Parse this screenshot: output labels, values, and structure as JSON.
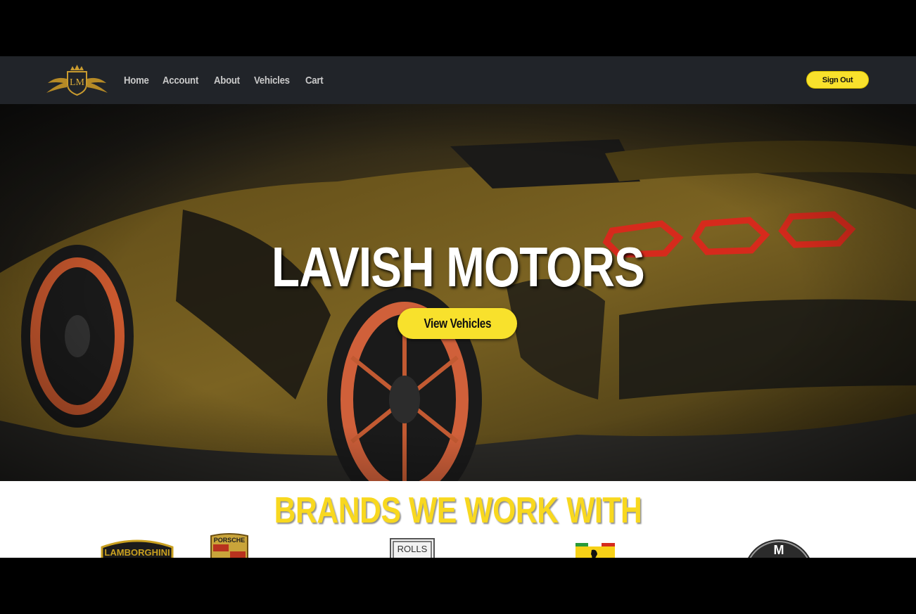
{
  "brand": {
    "logo_text": "LM"
  },
  "nav": {
    "items": [
      {
        "label": "Home"
      },
      {
        "label": "Account"
      },
      {
        "label": "About"
      },
      {
        "label": "Vehicles"
      },
      {
        "label": "Cart"
      }
    ],
    "sign_out_label": "Sign Out"
  },
  "hero": {
    "title": "LAVISH MOTORS",
    "cta_label": "View Vehicles"
  },
  "brands_section": {
    "title": "BRANDS WE WORK WITH",
    "logos": [
      {
        "text": "LAMBORGHINI"
      },
      {
        "text": "PORSCHE"
      },
      {
        "text": "ROLLS"
      },
      {
        "text": ""
      },
      {
        "text": "M"
      }
    ]
  },
  "colors": {
    "accent": "#f8e12c",
    "nav_bg": "#212429",
    "brand_gold": "#c99b2f"
  }
}
